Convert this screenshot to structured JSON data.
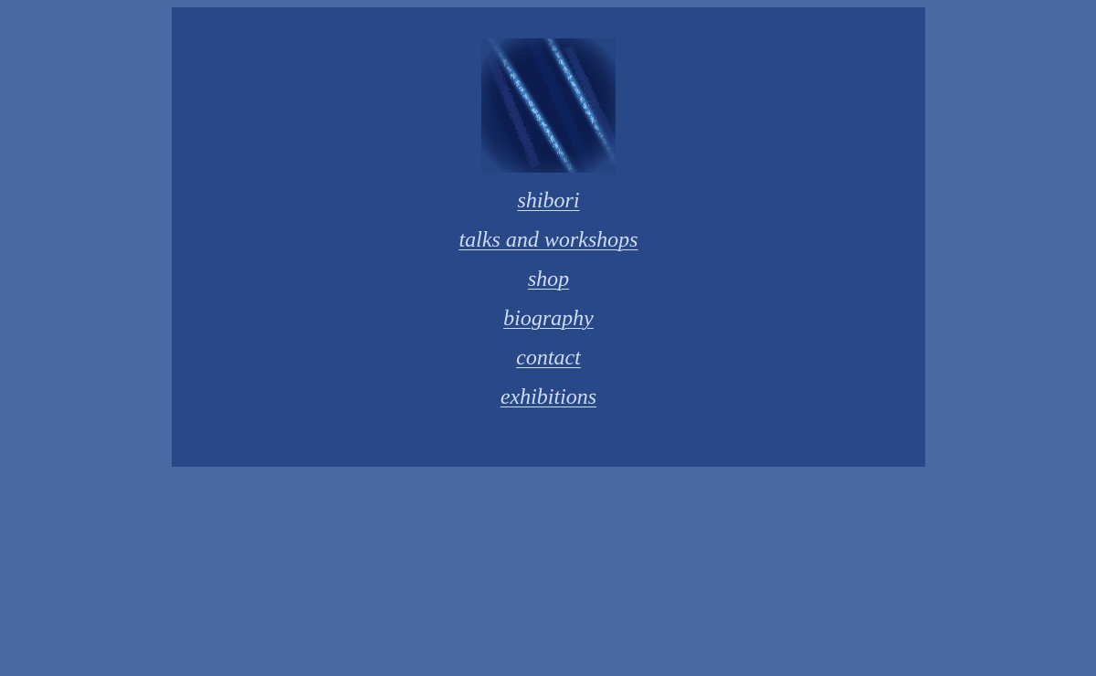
{
  "colors": {
    "page_background": "#4a68a2",
    "panel_background": "#284888",
    "link_color": "#cfdcf8"
  },
  "logo": {
    "icon": "indigo-shibori-fabric-image"
  },
  "nav": {
    "items": [
      {
        "label": "shibori"
      },
      {
        "label": "talks and workshops"
      },
      {
        "label": "shop"
      },
      {
        "label": "biography"
      },
      {
        "label": "contact"
      },
      {
        "label": "exhibitions"
      }
    ]
  }
}
